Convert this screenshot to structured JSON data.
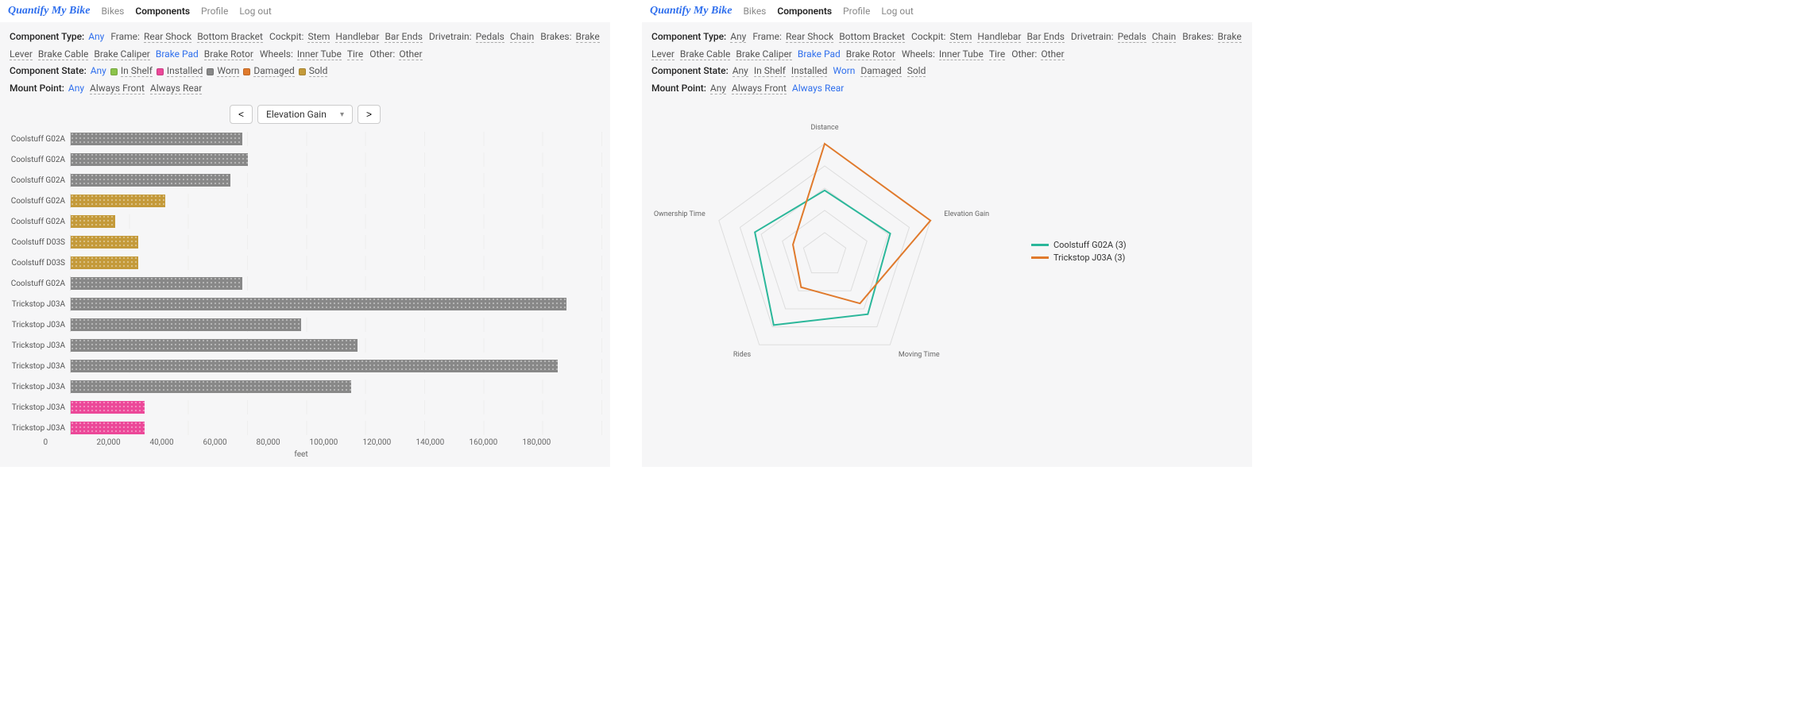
{
  "brand": "Quantify My Bike",
  "nav": {
    "bikes": "Bikes",
    "components": "Components",
    "profile": "Profile",
    "logout": "Log out"
  },
  "filters": {
    "componentType": {
      "label": "Component Type:",
      "any": "Any",
      "groups": {
        "frame": {
          "label": "Frame:",
          "items": [
            "Rear Shock",
            "Bottom Bracket"
          ]
        },
        "cockpit": {
          "label": "Cockpit:",
          "items": [
            "Stem",
            "Handlebar",
            "Bar Ends"
          ]
        },
        "drivetrain": {
          "label": "Drivetrain:",
          "items": [
            "Pedals",
            "Chain"
          ]
        },
        "brakes": {
          "label": "Brakes:",
          "items": [
            "Brake Lever",
            "Brake Cable",
            "Brake Caliper",
            "Brake Pad",
            "Brake Rotor"
          ]
        },
        "wheels": {
          "label": "Wheels:",
          "items": [
            "Inner Tube",
            "Tire"
          ]
        },
        "other": {
          "label": "Other:",
          "items": [
            "Other"
          ]
        }
      },
      "selected": "Brake Pad"
    },
    "componentState": {
      "label": "Component State:",
      "selectedLeft": "Any",
      "items": [
        {
          "label": "In Shelf",
          "color": "#8bc34a"
        },
        {
          "label": "Installed",
          "color": "#ec4899"
        },
        {
          "label": "Worn",
          "color": "#888888"
        },
        {
          "label": "Damaged",
          "color": "#e07a2c"
        },
        {
          "label": "Sold",
          "color": "#c49a3a"
        }
      ],
      "selectedRight": "Worn"
    },
    "mountPoint": {
      "label": "Mount Point:",
      "any": "Any",
      "items": [
        "Always Front",
        "Always Rear"
      ],
      "selectedLeft": "Any",
      "selectedRight": "Always Rear"
    }
  },
  "chartControls": {
    "prev": "<",
    "metric": "Elevation Gain",
    "next": ">"
  },
  "chart_data": [
    {
      "type": "bar",
      "orientation": "horizontal",
      "xlabel": "feet",
      "xlim": [
        0,
        180000
      ],
      "xticks": [
        0,
        20000,
        40000,
        60000,
        80000,
        100000,
        120000,
        140000,
        160000,
        180000
      ],
      "bars": [
        {
          "label": "Coolstuff G02A",
          "value": 58000,
          "state": "Worn"
        },
        {
          "label": "Coolstuff G02A",
          "value": 60000,
          "state": "Worn"
        },
        {
          "label": "Coolstuff G02A",
          "value": 54000,
          "state": "Worn"
        },
        {
          "label": "Coolstuff G02A",
          "value": 32000,
          "state": "Sold"
        },
        {
          "label": "Coolstuff G02A",
          "value": 15000,
          "state": "Sold"
        },
        {
          "label": "Coolstuff D03S",
          "value": 23000,
          "state": "Sold"
        },
        {
          "label": "Coolstuff D03S",
          "value": 23000,
          "state": "Sold"
        },
        {
          "label": "Coolstuff G02A",
          "value": 58000,
          "state": "Worn"
        },
        {
          "label": "Trickstop J03A",
          "value": 168000,
          "state": "Worn"
        },
        {
          "label": "Trickstop J03A",
          "value": 78000,
          "state": "Worn"
        },
        {
          "label": "Trickstop J03A",
          "value": 97000,
          "state": "Worn"
        },
        {
          "label": "Trickstop J03A",
          "value": 165000,
          "state": "Worn"
        },
        {
          "label": "Trickstop J03A",
          "value": 95000,
          "state": "Worn"
        },
        {
          "label": "Trickstop J03A",
          "value": 25000,
          "state": "Installed"
        },
        {
          "label": "Trickstop J03A",
          "value": 25000,
          "state": "Installed"
        }
      ]
    },
    {
      "type": "radar",
      "axes": [
        "Distance",
        "Elevation Gain",
        "Moving Time",
        "Rides",
        "Ownership Time"
      ],
      "scale_rings": 5,
      "series": [
        {
          "name": "Coolstuff G02A (3)",
          "color": "#2bb79a",
          "values": [
            0.58,
            0.62,
            0.66,
            0.78,
            0.66
          ]
        },
        {
          "name": "Trickstop J03A (3)",
          "color": "#e07a2c",
          "values": [
            1.0,
            1.0,
            0.54,
            0.36,
            0.3
          ]
        }
      ]
    }
  ]
}
